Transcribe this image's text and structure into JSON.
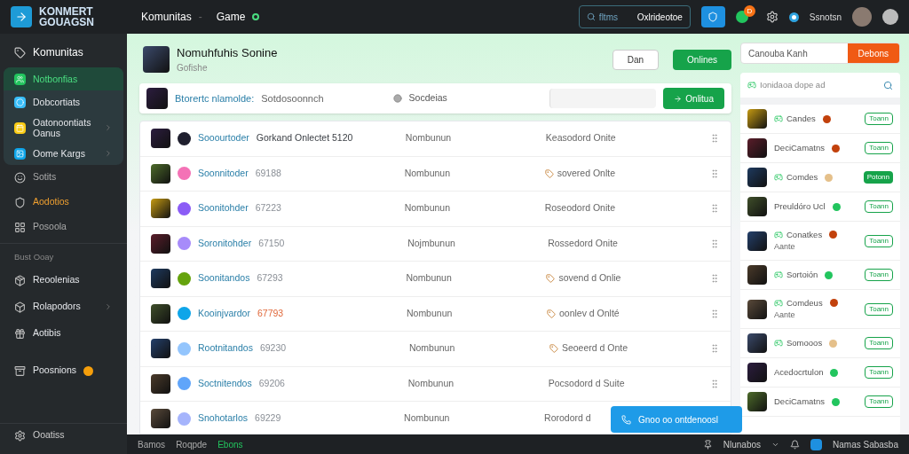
{
  "brand": {
    "line_1": "KONMERT",
    "line_2": "GOUAGSN"
  },
  "nav": [
    "Komunitas",
    "Game"
  ],
  "nav_separator": "-",
  "top_search": {
    "placeholder": "fltms",
    "value": "Oxlrideotoe"
  },
  "notification_badge": "D",
  "user": {
    "name": "Ssnotsn"
  },
  "sidebar": {
    "heading": "Komunitas",
    "group": [
      {
        "label": "Notbonfias",
        "selected": true,
        "color": "#22c55e",
        "chevron": false
      },
      {
        "label": "Dobcortiats",
        "selected": false,
        "color": "#38bdf8",
        "chevron": false
      },
      {
        "label": "Oatonoontiats Oanus",
        "selected": false,
        "color": "#facc15",
        "chevron": true
      },
      {
        "label": "Oome Kargs",
        "selected": false,
        "color": "#0ea5e9",
        "chevron": true
      }
    ],
    "items": [
      {
        "label": "Sotits",
        "accent": false,
        "chevron": false
      },
      {
        "label": "Aodotios",
        "accent": true,
        "chevron": false
      },
      {
        "label": "Posoola",
        "accent": false,
        "chevron": false
      }
    ],
    "section_title": "Bust Ooay",
    "section_items": [
      {
        "label": "Reoolenias",
        "chevron": false
      },
      {
        "label": "Rolapodors",
        "chevron": true
      },
      {
        "label": "Aotibis",
        "chevron": false
      }
    ],
    "special": {
      "label": "Poosnions",
      "badge": true
    },
    "footer": "Ooatiss"
  },
  "header": {
    "title": "Nomuhfuhis Sonine",
    "subtitle": "Gofishe",
    "buttons": [
      {
        "label": "Dan",
        "kind": "outline"
      },
      {
        "label": "Onlines",
        "kind": "primary"
      }
    ]
  },
  "side_field": {
    "placeholder": "Canouba Kanh",
    "button": "Debons"
  },
  "filter": {
    "label": "Btorertc nlamolde:",
    "value": "Sotdosoonnch",
    "option": "Socdeias",
    "button": "Onlitua"
  },
  "rows": [
    {
      "name": "Sooourtoder",
      "id": "Gorkand Onlectet 5120",
      "highlight": false,
      "members": "Nombunun",
      "status": "Keasodord Onite",
      "tagged": false
    },
    {
      "name": "Soonnitoder",
      "id": "69188",
      "highlight": false,
      "members": "Nombunun",
      "status": "sovered Onlte",
      "tagged": true
    },
    {
      "name": "Soonitohder",
      "id": "67223",
      "highlight": false,
      "members": "Nombunun",
      "status": "Roseodord Onite",
      "tagged": false
    },
    {
      "name": "Soronitohder",
      "id": "67150",
      "highlight": false,
      "members": "Nojmbunun",
      "status": "Rossedord Onite",
      "tagged": false
    },
    {
      "name": "Soonitandos",
      "id": "67293",
      "highlight": false,
      "members": "Nombunun",
      "status": "sovend d Onlie",
      "tagged": true
    },
    {
      "name": "Kooinjvardor",
      "id": "67793",
      "highlight": true,
      "members": "Nombunun",
      "status": "oonlev d Onlté",
      "tagged": true
    },
    {
      "name": "Rootnitandos",
      "id": "69230",
      "highlight": false,
      "members": "Nombunun",
      "status": "Seoeerd d Onte",
      "tagged": true
    },
    {
      "name": "Soctnitendos",
      "id": "69206",
      "highlight": false,
      "members": "Nombunun",
      "status": "Pocsodord d Suite",
      "tagged": false
    },
    {
      "name": "Snohotarlos",
      "id": "69229",
      "highlight": false,
      "members": "Nombunun",
      "status": "Rorodord d",
      "tagged": false
    }
  ],
  "float_button": "Gnoo oo ontdenoosl",
  "list_search": {
    "placeholder": "Ionidaoa dope ad"
  },
  "list": [
    {
      "name": "Candes",
      "tagged": true,
      "color": "#c2410c",
      "button": "Toann",
      "selected": false
    },
    {
      "name": "DeciCamatns",
      "tagged": false,
      "color": "#c2410c",
      "button": "Toann",
      "selected": false
    },
    {
      "name": "Comdes",
      "tagged": true,
      "color": "#e5c08a",
      "button": "Potonn",
      "selected": true
    },
    {
      "name": "Preuldóro Ucl",
      "tagged": false,
      "color": "#22c55e",
      "button": "Toann",
      "selected": false
    },
    {
      "name": "Conatkes",
      "tagged": true,
      "color": "#c2410c",
      "button": "Toann",
      "selected": false,
      "subtitle": "Aante"
    },
    {
      "name": "Sortoión",
      "tagged": true,
      "color": "#22c55e",
      "button": "Toann",
      "selected": false
    },
    {
      "name": "Comdeus",
      "tagged": true,
      "color": "#c2410c",
      "button": "Toann",
      "selected": false,
      "subtitle": "Aante"
    },
    {
      "name": "Somooos",
      "tagged": true,
      "color": "#e5c08a",
      "button": "Toann",
      "selected": false
    },
    {
      "name": "Acedocrtulon",
      "tagged": false,
      "color": "#22c55e",
      "button": "Toann",
      "selected": false
    },
    {
      "name": "DeciCamatns",
      "tagged": false,
      "color": "#22c55e",
      "button": "Toann",
      "selected": false
    }
  ],
  "status_bar": {
    "left": [
      {
        "label": "Bamos",
        "selected": false
      },
      {
        "label": "Roqpde",
        "selected": false
      },
      {
        "label": "Ebons",
        "selected": true
      }
    ],
    "right_menu": "Nlunabos",
    "app": "Namas Sabasba"
  }
}
